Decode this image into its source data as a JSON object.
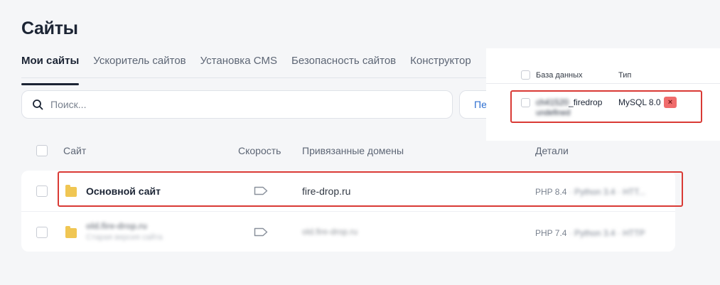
{
  "page": {
    "title": "Сайты"
  },
  "tabs": [
    {
      "label": "Мои сайты",
      "active": true
    },
    {
      "label": "Ускоритель сайтов"
    },
    {
      "label": "Установка CMS"
    },
    {
      "label": "Безопасность сайтов"
    },
    {
      "label": "Конструктор"
    }
  ],
  "search": {
    "placeholder": "Поиск..."
  },
  "new_button": {
    "label": "Пе"
  },
  "table": {
    "headers": {
      "site": "Сайт",
      "speed": "Скорость",
      "domains": "Привязанные домены",
      "details": "Детали"
    },
    "rows": [
      {
        "name": "Основной сайт",
        "domain": "fire-drop.ru",
        "details_visible": "PHP 8.4",
        "details_blurred": " · Python 3.4 · HTT..."
      },
      {
        "name_blurred": "old.fire-drop.ru",
        "subtitle_blurred": "Старая версия сайта",
        "domain_blurred": "old.fire-drop.ru",
        "details_visible": "PHP 7.4",
        "details_blurred": " · Python 3.4 · HTTP"
      }
    ]
  },
  "db_panel": {
    "headers": {
      "database": "База данных",
      "type": "Тип"
    },
    "row": {
      "name_prefix_blurred": "ch41520",
      "name_suffix": "_firedrop",
      "name_line2_blurred": "undefined",
      "type": "MySQL 8.0",
      "delete_symbol": "×"
    }
  },
  "colors": {
    "accent": "#2d6fd1",
    "highlight": "#d93a35",
    "folder": "#f0c653",
    "title": "#1b2434"
  }
}
